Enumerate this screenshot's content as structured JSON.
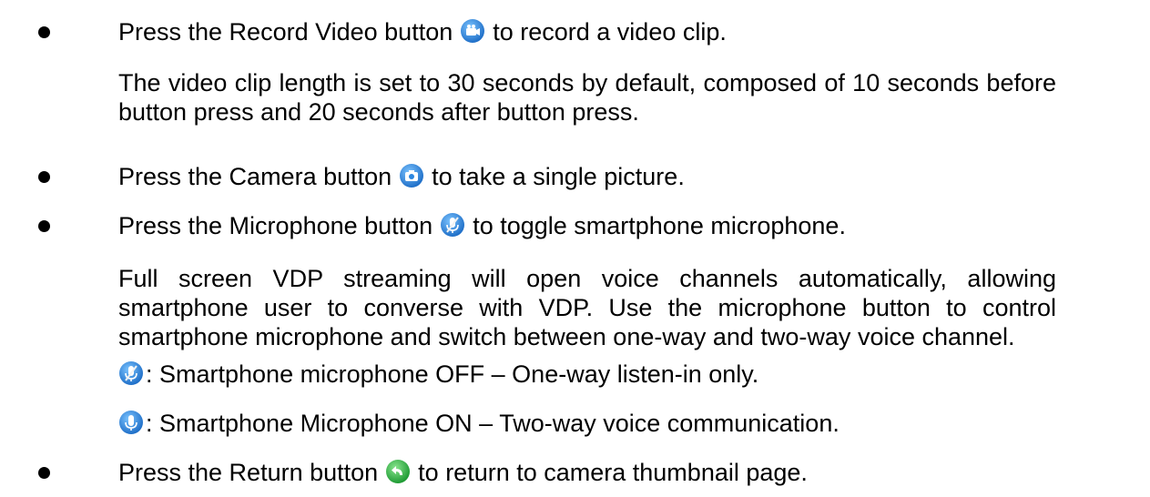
{
  "items": {
    "record": {
      "before": "Press the Record Video button",
      "after": "to record a video clip.",
      "icon": "video-camera-icon",
      "icon_color": "#2b86e0"
    },
    "record_note": "The video clip length is set to 30 seconds by default, composed of 10 seconds before button press and 20 seconds after button press.",
    "camera": {
      "before": "Press the Camera button",
      "after": "to take a single picture.",
      "icon": "camera-icon",
      "icon_color": "#2b86e0"
    },
    "mic": {
      "before": "Press the Microphone button",
      "after": "to toggle smartphone microphone.",
      "icon": "microphone-off-icon",
      "icon_color": "#2b86e0"
    },
    "mic_note": "Full screen VDP streaming will open voice channels automatically, allowing smartphone user to converse with VDP. Use the microphone button to control smartphone microphone and switch between one-way and two-way voice channel.",
    "mic_off": {
      "icon": "microphone-off-icon",
      "text": ": Smartphone microphone OFF – One-way listen-in only."
    },
    "mic_on": {
      "icon": "microphone-on-icon",
      "text": ": Smartphone Microphone ON – Two-way voice communication."
    },
    "return": {
      "before": "Press the Return button",
      "after": "to return to camera thumbnail page.",
      "icon": "return-arrow-icon",
      "icon_color": "#2fb544"
    }
  }
}
